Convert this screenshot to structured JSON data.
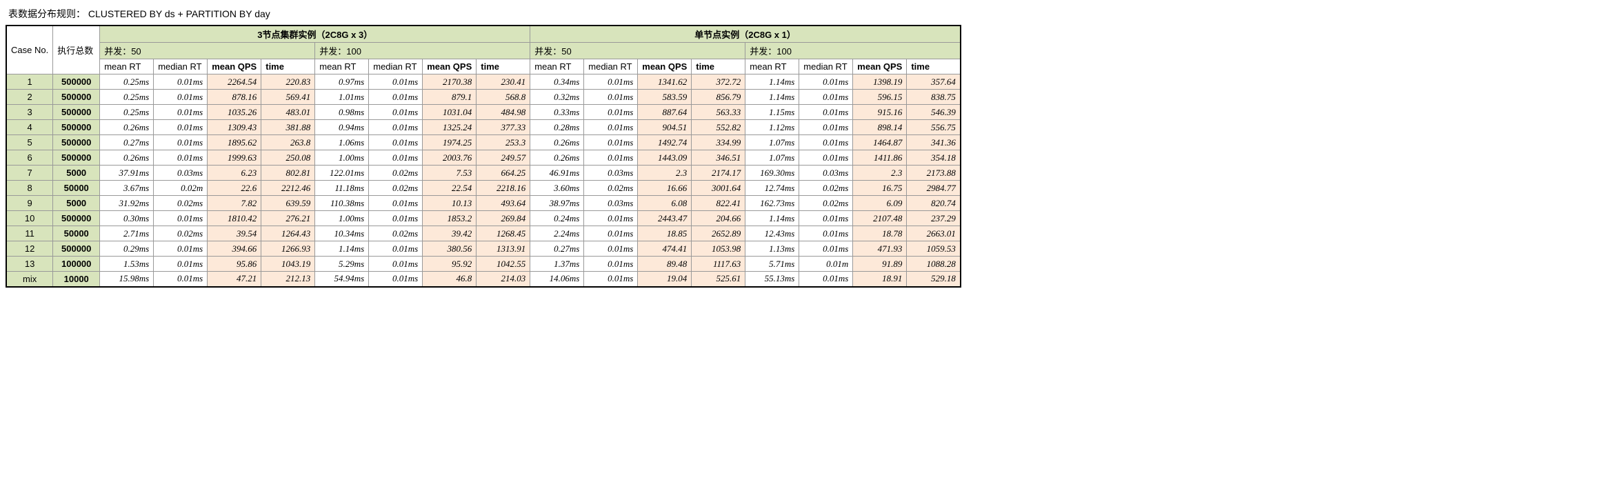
{
  "title": "表数据分布规则： CLUSTERED BY ds + PARTITION BY day",
  "clusters": [
    {
      "title": "3节点集群实例（2C8G x 3）"
    },
    {
      "title": "单节点实例（2C8G x 1）"
    }
  ],
  "conc_labels": {
    "c50": "并发：50",
    "c100": "并发：100"
  },
  "col_case": "Case No.",
  "col_exec": "执行总数",
  "metric_labels": {
    "mean_rt": "mean RT",
    "median_rt": "median RT",
    "mean_qps": "mean QPS",
    "time": "time"
  },
  "rows": [
    {
      "case": "1",
      "exec": "500000",
      "g": [
        [
          "0.25ms",
          "0.01ms",
          "2264.54",
          "220.83"
        ],
        [
          "0.97ms",
          "0.01ms",
          "2170.38",
          "230.41"
        ],
        [
          "0.34ms",
          "0.01ms",
          "1341.62",
          "372.72"
        ],
        [
          "1.14ms",
          "0.01ms",
          "1398.19",
          "357.64"
        ]
      ]
    },
    {
      "case": "2",
      "exec": "500000",
      "g": [
        [
          "0.25ms",
          "0.01ms",
          "878.16",
          "569.41"
        ],
        [
          "1.01ms",
          "0.01ms",
          "879.1",
          "568.8"
        ],
        [
          "0.32ms",
          "0.01ms",
          "583.59",
          "856.79"
        ],
        [
          "1.14ms",
          "0.01ms",
          "596.15",
          "838.75"
        ]
      ]
    },
    {
      "case": "3",
      "exec": "500000",
      "g": [
        [
          "0.25ms",
          "0.01ms",
          "1035.26",
          "483.01"
        ],
        [
          "0.98ms",
          "0.01ms",
          "1031.04",
          "484.98"
        ],
        [
          "0.33ms",
          "0.01ms",
          "887.64",
          "563.33"
        ],
        [
          "1.15ms",
          "0.01ms",
          "915.16",
          "546.39"
        ]
      ]
    },
    {
      "case": "4",
      "exec": "500000",
      "g": [
        [
          "0.26ms",
          "0.01ms",
          "1309.43",
          "381.88"
        ],
        [
          "0.94ms",
          "0.01ms",
          "1325.24",
          "377.33"
        ],
        [
          "0.28ms",
          "0.01ms",
          "904.51",
          "552.82"
        ],
        [
          "1.12ms",
          "0.01ms",
          "898.14",
          "556.75"
        ]
      ]
    },
    {
      "case": "5",
      "exec": "500000",
      "g": [
        [
          "0.27ms",
          "0.01ms",
          "1895.62",
          "263.8"
        ],
        [
          "1.06ms",
          "0.01ms",
          "1974.25",
          "253.3"
        ],
        [
          "0.26ms",
          "0.01ms",
          "1492.74",
          "334.99"
        ],
        [
          "1.07ms",
          "0.01ms",
          "1464.87",
          "341.36"
        ]
      ]
    },
    {
      "case": "6",
      "exec": "500000",
      "g": [
        [
          "0.26ms",
          "0.01ms",
          "1999.63",
          "250.08"
        ],
        [
          "1.00ms",
          "0.01ms",
          "2003.76",
          "249.57"
        ],
        [
          "0.26ms",
          "0.01ms",
          "1443.09",
          "346.51"
        ],
        [
          "1.07ms",
          "0.01ms",
          "1411.86",
          "354.18"
        ]
      ]
    },
    {
      "case": "7",
      "exec": "5000",
      "g": [
        [
          "37.91ms",
          "0.03ms",
          "6.23",
          "802.81"
        ],
        [
          "122.01ms",
          "0.02ms",
          "7.53",
          "664.25"
        ],
        [
          "46.91ms",
          "0.03ms",
          "2.3",
          "2174.17"
        ],
        [
          "169.30ms",
          "0.03ms",
          "2.3",
          "2173.88"
        ]
      ]
    },
    {
      "case": "8",
      "exec": "50000",
      "g": [
        [
          "3.67ms",
          "0.02m",
          "22.6",
          "2212.46"
        ],
        [
          "11.18ms",
          "0.02ms",
          "22.54",
          "2218.16"
        ],
        [
          "3.60ms",
          "0.02ms",
          "16.66",
          "3001.64"
        ],
        [
          "12.74ms",
          "0.02ms",
          "16.75",
          "2984.77"
        ]
      ]
    },
    {
      "case": "9",
      "exec": "5000",
      "g": [
        [
          "31.92ms",
          "0.02ms",
          "7.82",
          "639.59"
        ],
        [
          "110.38ms",
          "0.01ms",
          "10.13",
          "493.64"
        ],
        [
          "38.97ms",
          "0.03ms",
          "6.08",
          "822.41"
        ],
        [
          "162.73ms",
          "0.02ms",
          "6.09",
          "820.74"
        ]
      ]
    },
    {
      "case": "10",
      "exec": "500000",
      "g": [
        [
          "0.30ms",
          "0.01ms",
          "1810.42",
          "276.21"
        ],
        [
          "1.00ms",
          "0.01ms",
          "1853.2",
          "269.84"
        ],
        [
          "0.24ms",
          "0.01ms",
          "2443.47",
          "204.66"
        ],
        [
          "1.14ms",
          "0.01ms",
          "2107.48",
          "237.29"
        ]
      ]
    },
    {
      "case": "11",
      "exec": "50000",
      "g": [
        [
          "2.71ms",
          "0.02ms",
          "39.54",
          "1264.43"
        ],
        [
          "10.34ms",
          "0.02ms",
          "39.42",
          "1268.45"
        ],
        [
          "2.24ms",
          "0.01ms",
          "18.85",
          "2652.89"
        ],
        [
          "12.43ms",
          "0.01ms",
          "18.78",
          "2663.01"
        ]
      ]
    },
    {
      "case": "12",
      "exec": "500000",
      "g": [
        [
          "0.29ms",
          "0.01ms",
          "394.66",
          "1266.93"
        ],
        [
          "1.14ms",
          "0.01ms",
          "380.56",
          "1313.91"
        ],
        [
          "0.27ms",
          "0.01ms",
          "474.41",
          "1053.98"
        ],
        [
          "1.13ms",
          "0.01ms",
          "471.93",
          "1059.53"
        ]
      ]
    },
    {
      "case": "13",
      "exec": "100000",
      "g": [
        [
          "1.53ms",
          "0.01ms",
          "95.86",
          "1043.19"
        ],
        [
          "5.29ms",
          "0.01ms",
          "95.92",
          "1042.55"
        ],
        [
          "1.37ms",
          "0.01ms",
          "89.48",
          "1117.63"
        ],
        [
          "5.71ms",
          "0.01m",
          "91.89",
          "1088.28"
        ]
      ]
    },
    {
      "case": "mix",
      "exec": "10000",
      "g": [
        [
          "15.98ms",
          "0.01ms",
          "47.21",
          "212.13"
        ],
        [
          "54.94ms",
          "0.01ms",
          "46.8",
          "214.03"
        ],
        [
          "14.06ms",
          "0.01ms",
          "19.04",
          "525.61"
        ],
        [
          "55.13ms",
          "0.01ms",
          "18.91",
          "529.18"
        ]
      ]
    }
  ]
}
